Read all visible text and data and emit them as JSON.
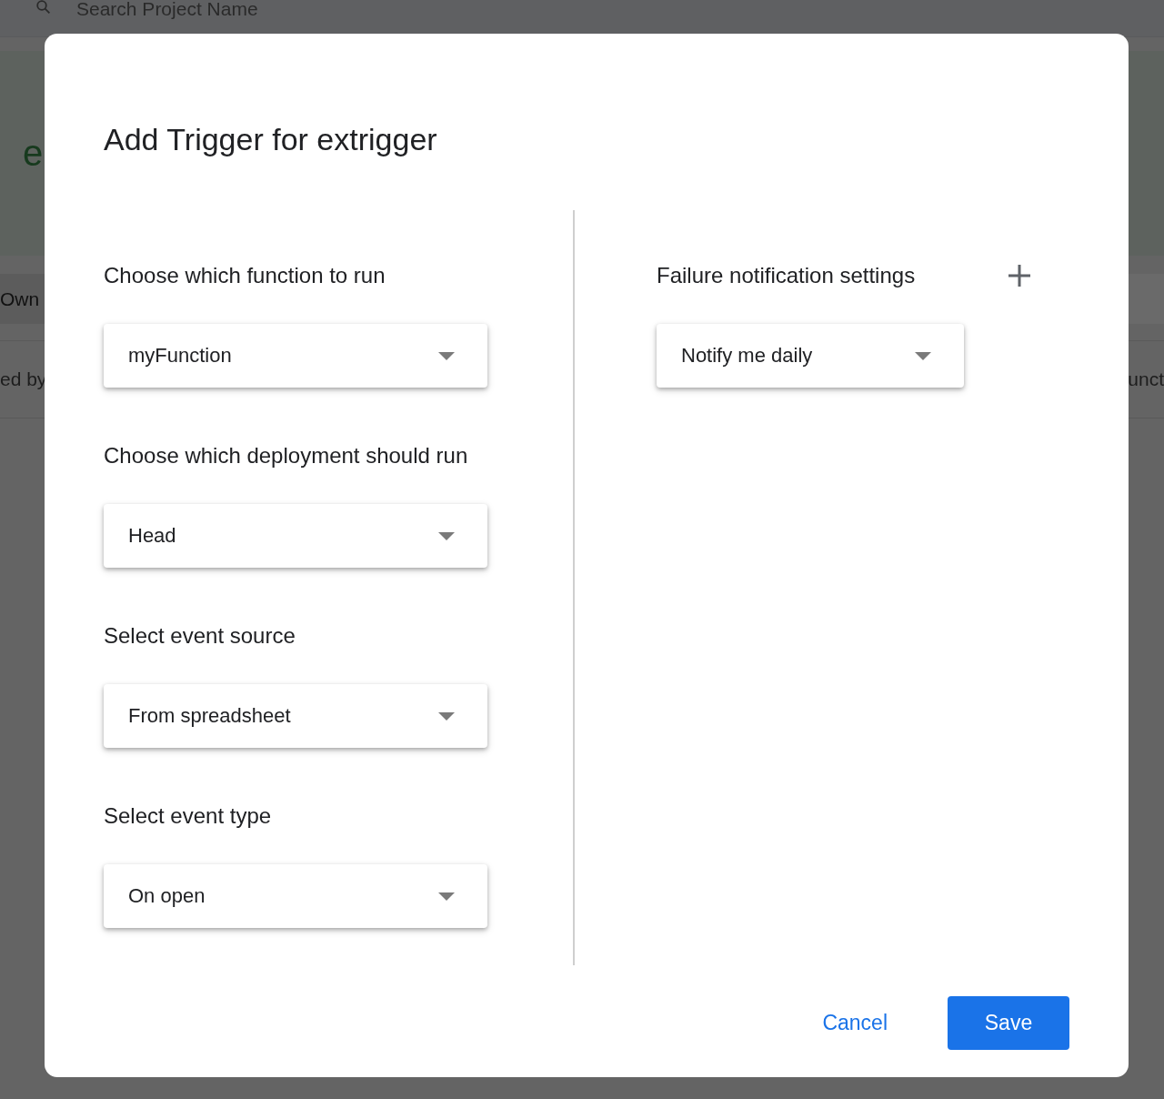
{
  "background": {
    "search_placeholder": "Search Project Name",
    "project_title": "e",
    "tab": "Own",
    "column_1": "ed by",
    "column_2": "unct"
  },
  "dialog": {
    "title": "Add Trigger for extrigger",
    "fields": [
      {
        "label": "Choose which function to run",
        "value": "myFunction"
      },
      {
        "label": "Choose which deployment should run",
        "value": "Head"
      },
      {
        "label": "Select event source",
        "value": "From spreadsheet"
      },
      {
        "label": "Select event type",
        "value": "On open"
      }
    ],
    "notification": {
      "label": "Failure notification settings",
      "value": "Notify me daily"
    },
    "buttons": [
      {
        "label": "Cancel",
        "kind": "text"
      },
      {
        "label": "Save",
        "kind": "primary"
      }
    ]
  }
}
